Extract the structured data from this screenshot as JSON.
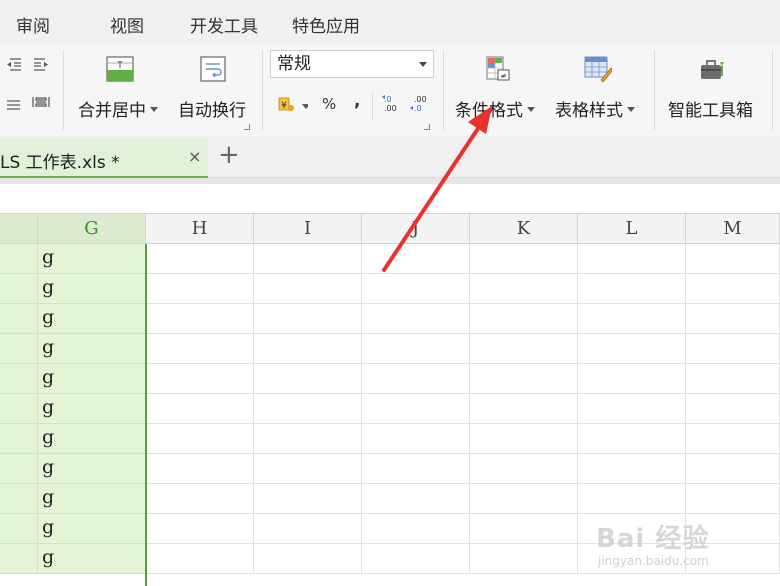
{
  "menu": {
    "items": [
      "审阅",
      "视图",
      "开发工具",
      "特色应用"
    ]
  },
  "ribbon": {
    "merge_center": "合并居中",
    "wrap_text": "自动换行",
    "number_format": "常规",
    "percent_symbol": "%",
    "comma_symbol": ",",
    "increase_decimal": ".0\n.00",
    "decrease_decimal": ".00\n.0",
    "conditional_format": "条件格式",
    "table_style": "表格样式",
    "smart_toolbox": "智能工具箱"
  },
  "tabs": {
    "doc_title": "LS 工作表.xls *",
    "close_symbol": "×",
    "add_symbol": "+"
  },
  "sheet": {
    "columns": [
      "G",
      "H",
      "I",
      "J",
      "K",
      "L",
      "M"
    ],
    "selected_column": "G",
    "g_values": [
      "g",
      "g",
      "g",
      "g",
      "g",
      "g",
      "g",
      "g",
      "g",
      "g",
      "g"
    ]
  },
  "annotation": {
    "color": "#e8322b"
  },
  "watermark": {
    "main": "Bai 经验",
    "sub": "jingyan.baidu.com"
  },
  "colors": {
    "selected_green": "#5a9e3c",
    "selected_fill": "#e3f5d6",
    "tab_active": "#e2efd9"
  }
}
